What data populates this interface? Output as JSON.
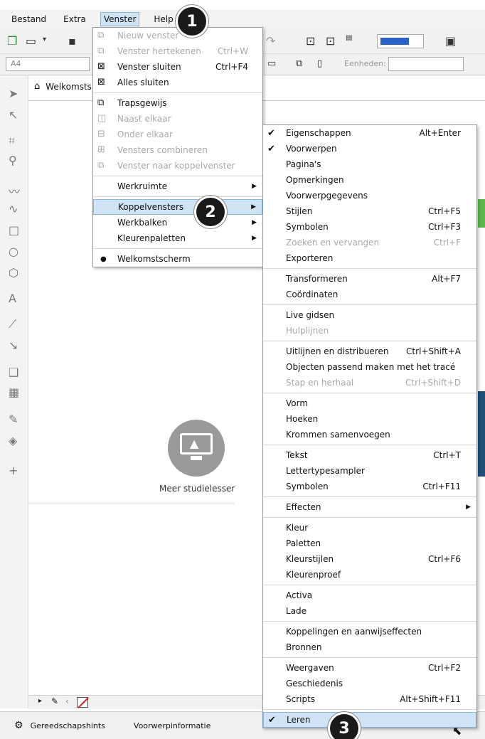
{
  "menubar": {
    "items": [
      "Bestand",
      "Extra",
      "Venster",
      "Help"
    ]
  },
  "toolbar2": {
    "page_size": "A4",
    "units_label": "Eenheden:"
  },
  "tabs": {
    "home_label": "Welkomsts"
  },
  "canvas": {
    "learn_text": "Meer studielesser"
  },
  "statusbar": {
    "hints_label": "Gereedschapshints",
    "info_label": "Voorwerpinformatie"
  },
  "venster_menu": {
    "items": [
      {
        "label": "Nieuw venster",
        "shortcut": "",
        "disabled": true,
        "icon": "new-window-icon"
      },
      {
        "label": "Venster hertekenen",
        "shortcut": "Ctrl+W",
        "disabled": true,
        "icon": "redraw-icon"
      },
      {
        "label": "Venster sluiten",
        "shortcut": "Ctrl+F4",
        "disabled": false,
        "icon": "close-window-icon"
      },
      {
        "label": "Alles sluiten",
        "shortcut": "",
        "disabled": false,
        "icon": "close-all-icon"
      },
      {
        "label": "Trapsgewijs",
        "shortcut": "",
        "disabled": false,
        "icon": "cascade-icon"
      },
      {
        "label": "Naast elkaar",
        "shortcut": "",
        "disabled": true,
        "icon": "tile-horizontal-icon"
      },
      {
        "label": "Onder elkaar",
        "shortcut": "",
        "disabled": true,
        "icon": "tile-vertical-icon"
      },
      {
        "label": "Vensters combineren",
        "shortcut": "",
        "disabled": true,
        "icon": "combine-icon"
      },
      {
        "label": "Venster naar koppelvenster",
        "shortcut": "",
        "disabled": true,
        "icon": "dock-icon"
      },
      {
        "label": "Werkruimte",
        "submenu": true
      },
      {
        "label": "Koppelvensters",
        "submenu": true,
        "highlighted": true
      },
      {
        "label": "Werkbalken",
        "submenu": true
      },
      {
        "label": "Kleurenpaletten",
        "submenu": true
      },
      {
        "label": "Welkomstscherm",
        "bullet": true
      }
    ]
  },
  "koppel_menu": {
    "items": [
      {
        "label": "Eigenschappen",
        "shortcut": "Alt+Enter",
        "checked": true
      },
      {
        "label": "Voorwerpen",
        "checked": true
      },
      {
        "label": "Pagina's"
      },
      {
        "label": "Opmerkingen"
      },
      {
        "label": "Voorwerpgegevens"
      },
      {
        "label": "Stijlen",
        "shortcut": "Ctrl+F5"
      },
      {
        "label": "Symbolen",
        "shortcut": "Ctrl+F3"
      },
      {
        "label": "Zoeken en vervangen",
        "shortcut": "Ctrl+F",
        "disabled": true
      },
      {
        "label": "Exporteren"
      },
      {
        "label": "Transformeren",
        "shortcut": "Alt+F7"
      },
      {
        "label": "Coördinaten"
      },
      {
        "label": "Live gidsen"
      },
      {
        "label": "Hulplijnen",
        "disabled": true
      },
      {
        "label": "Uitlijnen en distribueren",
        "shortcut": "Ctrl+Shift+A"
      },
      {
        "label": "Objecten passend maken met het tracé"
      },
      {
        "label": "Stap en herhaal",
        "shortcut": "Ctrl+Shift+D",
        "disabled": true
      },
      {
        "label": "Vorm"
      },
      {
        "label": "Hoeken"
      },
      {
        "label": "Krommen samenvoegen"
      },
      {
        "label": "Tekst",
        "shortcut": "Ctrl+T"
      },
      {
        "label": "Lettertypesampler"
      },
      {
        "label": "Symbolen",
        "shortcut": "Ctrl+F11"
      },
      {
        "label": "Effecten",
        "submenu": true
      },
      {
        "label": "Kleur"
      },
      {
        "label": "Paletten"
      },
      {
        "label": "Kleurstijlen",
        "shortcut": "Ctrl+F6"
      },
      {
        "label": "Kleurenproef"
      },
      {
        "label": "Activa"
      },
      {
        "label": "Lade"
      },
      {
        "label": "Koppelingen en aanwijseffecten"
      },
      {
        "label": "Bronnen"
      },
      {
        "label": "Weergaven",
        "shortcut": "Ctrl+F2"
      },
      {
        "label": "Geschiedenis"
      },
      {
        "label": "Scripts",
        "shortcut": "Alt+Shift+F11"
      },
      {
        "label": "Leren",
        "checked": true,
        "highlighted": true
      }
    ]
  },
  "badges": [
    "1",
    "2",
    "3"
  ],
  "colors": {
    "highlight": "#cfe3f5",
    "badge": "#1a1a1a"
  }
}
